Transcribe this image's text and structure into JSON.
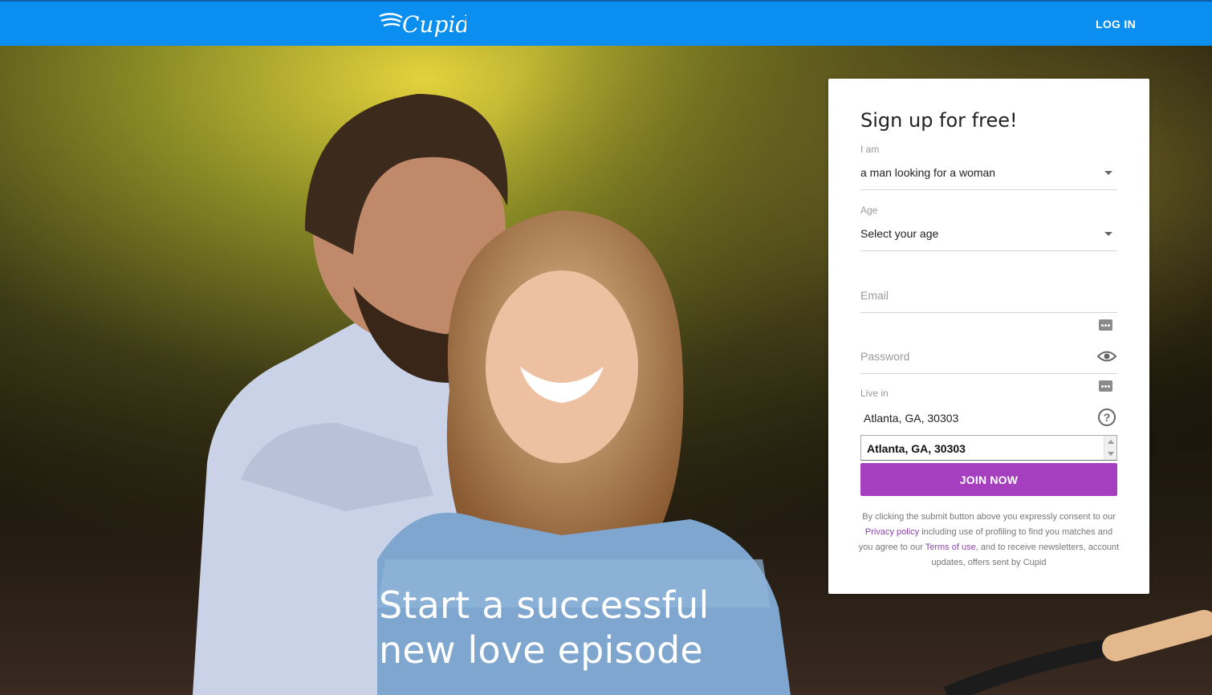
{
  "header": {
    "brand": "Cupid",
    "login_label": "LOG IN"
  },
  "hero": {
    "tagline_line1": "Start a successful",
    "tagline_line2": "new love episode"
  },
  "signup": {
    "title": "Sign up for free!",
    "i_am_label": "I am",
    "i_am_value": "a man looking for a woman",
    "age_label": "Age",
    "age_value": "Select your age",
    "email_placeholder": "Email",
    "password_placeholder": "Password",
    "live_in_label": "Live in",
    "live_in_value": "Atlanta, GA, 30303",
    "live_in_suggestion": "Atlanta, GA, 30303",
    "join_label": "JOIN NOW",
    "legal": {
      "part1": "By clicking the submit button above you expressly consent to our ",
      "privacy_link": "Privacy policy",
      "part2": " including use of profiling to find you matches and you agree to our ",
      "terms_link": "Terms of use",
      "part3": ", and to receive newsletters, account updates, offers sent by Cupid"
    }
  },
  "colors": {
    "header_blue": "#0a8ef0",
    "join_purple": "#a63fbf",
    "link_purple": "#8e44ad"
  }
}
